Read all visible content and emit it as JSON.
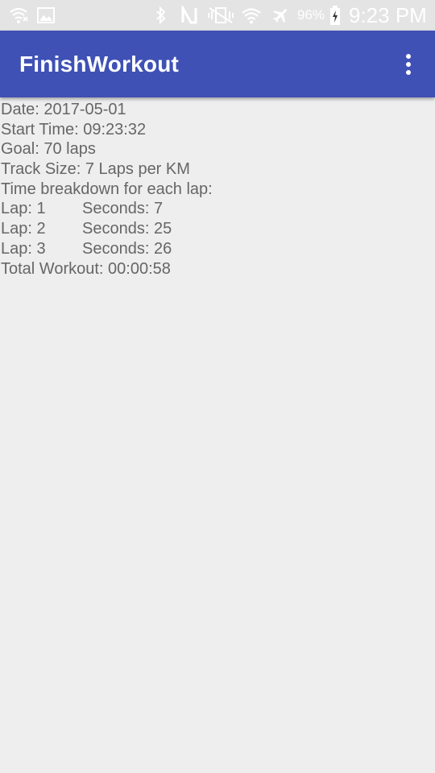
{
  "status_bar": {
    "battery_percent": "96%",
    "time": "9:23 PM",
    "icons": [
      "wifi-off-icon",
      "image-icon",
      "bluetooth-icon",
      "nfc-icon",
      "vibrate-icon",
      "wifi-icon",
      "airplane-icon",
      "battery-charging-icon"
    ]
  },
  "app_bar": {
    "title": "FinishWorkout",
    "menu_icon": "more-vert-icon",
    "color": "#3f51b5"
  },
  "summary": {
    "date": "Date: 2017-05-01",
    "start_time": "Start Time: 09:23:32",
    "goal": "Goal: 70 laps",
    "track_size": "Track Size: 7 Laps per KM",
    "breakdown_heading": "Time breakdown for each lap:",
    "laps": [
      {
        "lap": "Lap: 1",
        "seconds": "Seconds: 7"
      },
      {
        "lap": "Lap: 2",
        "seconds": "Seconds: 25"
      },
      {
        "lap": "Lap: 3",
        "seconds": "Seconds: 26"
      }
    ],
    "total": "Total Workout: 00:00:58"
  }
}
